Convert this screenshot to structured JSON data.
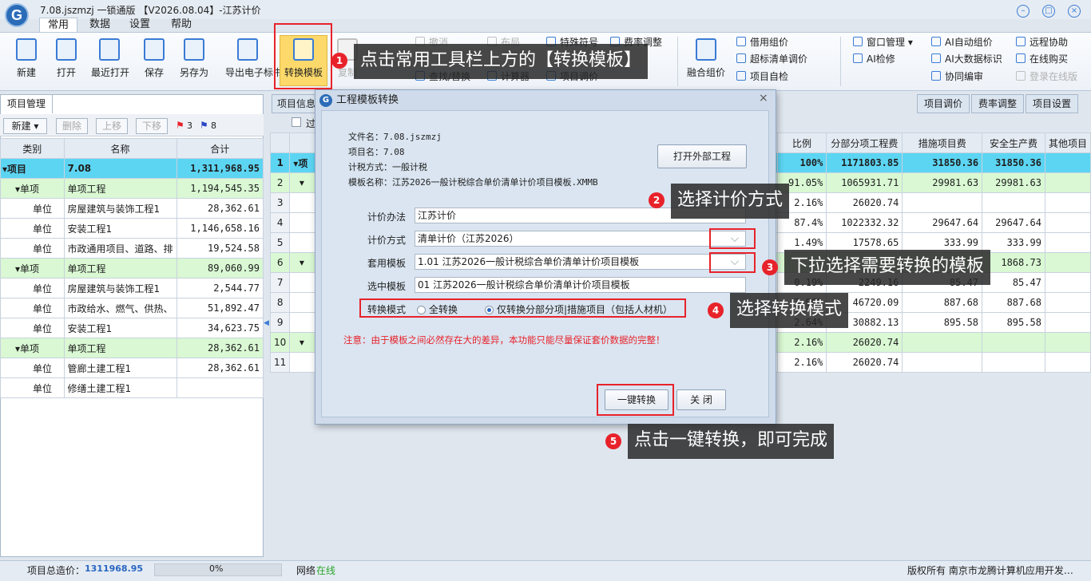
{
  "app": {
    "title": "7.08.jszmzj 一锁通版 【V2026.08.04】-江苏计价",
    "logo": "G"
  },
  "menu_tabs": [
    "常用",
    "数据",
    "设置",
    "帮助"
  ],
  "ribbon": {
    "big": [
      "新建",
      "打开",
      "最近打开",
      "保存",
      "另存为",
      "导出电子标书",
      "转换模板",
      "复制"
    ],
    "small_a": [
      "撤消",
      "恢复"
    ],
    "small_b": [
      "布局",
      "查找/替换",
      "计算器"
    ],
    "small_c": [
      "特殊符号",
      "费率调整",
      "项目调价"
    ],
    "merge": "融合组价",
    "small_d": [
      "借用组价",
      "超标清单调价",
      "项目自检"
    ],
    "small_e": [
      "窗口管理",
      "AI检修"
    ],
    "small_f": [
      "AI自动组价",
      "AI大数据标识",
      "协同编审"
    ],
    "small_g": [
      "远程协助",
      "在线购买",
      "登录在线版"
    ]
  },
  "left": {
    "tab": "项目管理",
    "toolbar": {
      "new": "新建",
      "delete": "删除",
      "up": "上移",
      "down": "下移",
      "flag_red": "3",
      "flag_blue": "8"
    },
    "headers": [
      "类别",
      "名称",
      "合计"
    ],
    "rows": [
      {
        "type": "项目",
        "name": "7.08",
        "total": "1,311,968.95",
        "cls": "proj",
        "indent": 0
      },
      {
        "type": "单项",
        "name": "单项工程",
        "total": "1,194,545.35",
        "cls": "unit",
        "indent": 1
      },
      {
        "type": "单位",
        "name": "房屋建筑与装饰工程1",
        "total": "28,362.61",
        "cls": "",
        "indent": 2
      },
      {
        "type": "单位",
        "name": "安装工程1",
        "total": "1,146,658.16",
        "cls": "",
        "indent": 2
      },
      {
        "type": "单位",
        "name": "市政通用项目、道路、排",
        "total": "19,524.58",
        "cls": "",
        "indent": 2
      },
      {
        "type": "单项",
        "name": "单项工程",
        "total": "89,060.99",
        "cls": "unit",
        "indent": 1
      },
      {
        "type": "单位",
        "name": "房屋建筑与装饰工程1",
        "total": "2,544.77",
        "cls": "",
        "indent": 2
      },
      {
        "type": "单位",
        "name": "市政给水、燃气、供热、",
        "total": "51,892.47",
        "cls": "",
        "indent": 2
      },
      {
        "type": "单位",
        "name": "安装工程1",
        "total": "34,623.75",
        "cls": "",
        "indent": 2
      },
      {
        "type": "单项",
        "name": "单项工程",
        "total": "28,362.61",
        "cls": "unit",
        "indent": 1
      },
      {
        "type": "单位",
        "name": "管廊土建工程1",
        "total": "28,362.61",
        "cls": "",
        "indent": 2
      },
      {
        "type": "单位",
        "name": "修缮土建工程1",
        "total": "",
        "cls": "",
        "indent": 2
      }
    ]
  },
  "right": {
    "tabs": [
      "项目信息",
      "项目调价",
      "费率调整",
      "项目设置"
    ],
    "check_label": "过",
    "headers": [
      "比例",
      "分部分项工程费",
      "措施项目费",
      "安全生产费",
      "其他项目"
    ],
    "first_col": "项",
    "rows": [
      {
        "no": "1",
        "ratio": "100%",
        "a": "1171803.85",
        "b": "31850.36",
        "c": "31850.36",
        "cls": "proj"
      },
      {
        "no": "2",
        "ratio": "91.05%",
        "a": "1065931.71",
        "b": "29981.63",
        "c": "29981.63",
        "cls": "unit"
      },
      {
        "no": "3",
        "ratio": "2.16%",
        "a": "26020.74",
        "b": "",
        "c": "",
        "cls": ""
      },
      {
        "no": "4",
        "ratio": "87.4%",
        "a": "1022332.32",
        "b": "29647.64",
        "c": "29647.64",
        "cls": ""
      },
      {
        "no": "5",
        "ratio": "1.49%",
        "a": "17578.65",
        "b": "333.99",
        "c": "333.99",
        "cls": ""
      },
      {
        "no": "6",
        "ratio": "",
        "a": "",
        "b": "",
        "c": "1868.73",
        "cls": "unit"
      },
      {
        "no": "7",
        "ratio": "0.19%",
        "a": "2249.16",
        "b": "85.47",
        "c": "85.47",
        "cls": ""
      },
      {
        "no": "8",
        "ratio": "3.96%",
        "a": "46720.09",
        "b": "887.68",
        "c": "887.68",
        "cls": ""
      },
      {
        "no": "9",
        "ratio": "2.64%",
        "a": "30882.13",
        "b": "895.58",
        "c": "895.58",
        "cls": ""
      },
      {
        "no": "10",
        "ratio": "2.16%",
        "a": "26020.74",
        "b": "",
        "c": "",
        "cls": "unit"
      },
      {
        "no": "11",
        "ratio": "2.16%",
        "a": "26020.74",
        "b": "",
        "c": "",
        "cls": ""
      }
    ]
  },
  "dialog": {
    "title": "工程模板转换",
    "file_name": "文件名：7.08.jszmzj",
    "project_name": "项目名：7.08",
    "tax_method": "计税方式：一般计税",
    "template_name": "模板名称：江苏2026一般计税综合单价清单计价项目模板.XMMB",
    "open_external": "打开外部工程",
    "fields": [
      {
        "label": "计价办法",
        "value": "江苏计价"
      },
      {
        "label": "计价方式",
        "value": "清单计价（江苏2026）"
      },
      {
        "label": "套用模板",
        "value": "1.01 江苏2026一般计税综合单价清单计价项目模板"
      },
      {
        "label": "选中模板",
        "value": "01 江苏2026一般计税综合单价清单计价项目模板"
      }
    ],
    "mode_label": "转换模式",
    "mode_options": [
      "全转换",
      "仅转换分部分项|措施项目（包括人材机）"
    ],
    "mode_selected": 1,
    "warning": "注意：由于模板之间必然存在大的差异，本功能只能尽量保证套价数据的完整！",
    "convert_button": "一键转换",
    "close_button": "关 闭"
  },
  "annotations": [
    {
      "n": "1",
      "text": "点击常用工具栏上方的【转换模板】"
    },
    {
      "n": "2",
      "text": "选择计价方式"
    },
    {
      "n": "3",
      "text": "下拉选择需要转换的模板"
    },
    {
      "n": "4",
      "text": "选择转换模式"
    },
    {
      "n": "5",
      "text": "点击一键转换，即可完成"
    }
  ],
  "status": {
    "total_label": "项目总造价：",
    "total_value": "1311968.95",
    "progress": "0%",
    "progress_value": 0,
    "network_label": "网络",
    "network_state": "在线",
    "copyright": "版权所有 南京市龙腾计算机应用开发…"
  },
  "colors": {
    "accent": "#3a7bd5",
    "highlight": "#5cd5f3",
    "unit_row": "#d9f8d3",
    "annotation_red": "#e8222a"
  }
}
